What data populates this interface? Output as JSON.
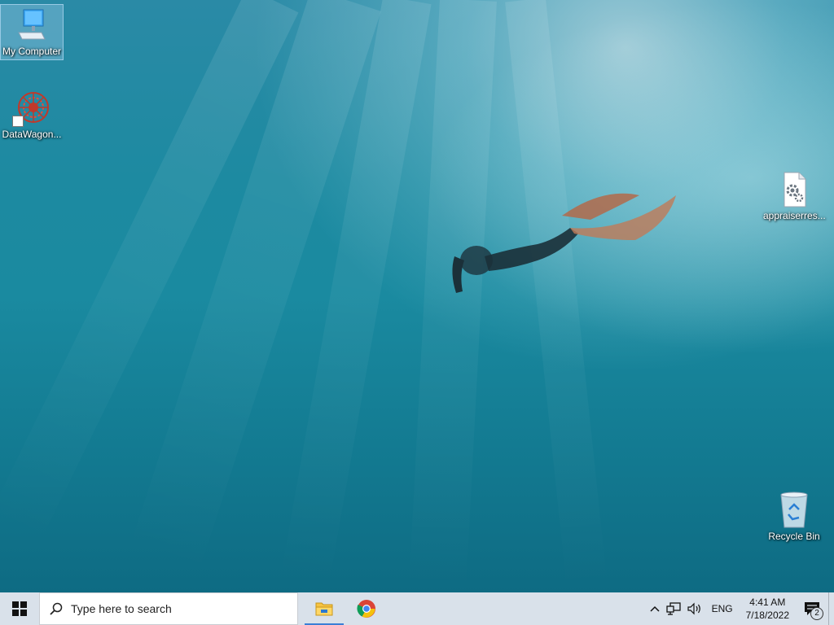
{
  "desktop": {
    "icons": [
      {
        "label": "My Computer"
      },
      {
        "label": "DataWagon..."
      },
      {
        "label": "appraiserres..."
      },
      {
        "label": "Recycle Bin"
      }
    ]
  },
  "taskbar": {
    "search_placeholder": "Type here to search",
    "apps": [
      "file-explorer",
      "chrome"
    ],
    "tray": {
      "language": "ENG",
      "time": "4:41 AM",
      "date": "7/18/2022",
      "notification_count": "2"
    }
  },
  "colors": {
    "taskbar_bg": "#d9e1ea",
    "accent": "#3b7fd6"
  }
}
